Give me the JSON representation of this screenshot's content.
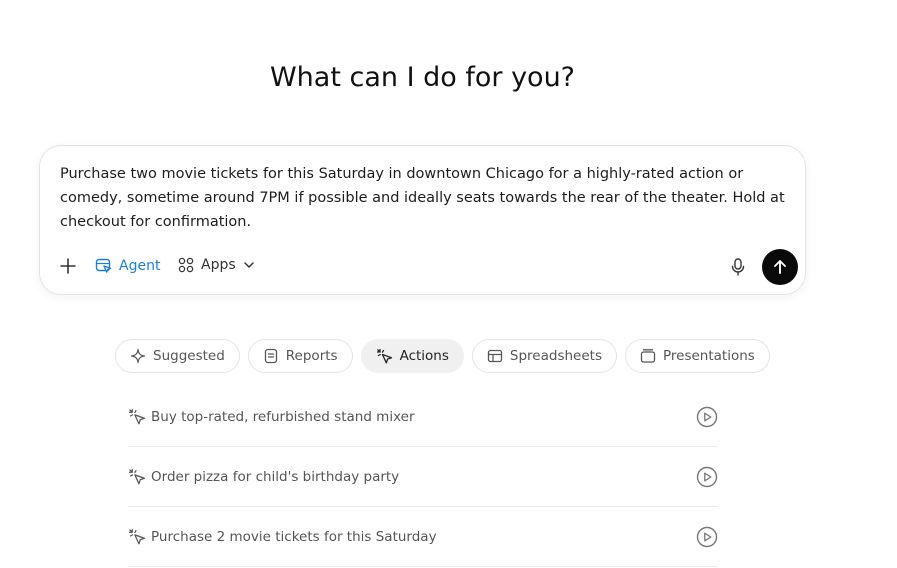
{
  "heading": "What can I do for you?",
  "composer": {
    "prompt_text": "Purchase two movie tickets for this Saturday in downtown Chicago for a highly-rated action or comedy, sometime around 7PM if possible and ideally seats towards the rear of the theater. Hold at checkout for confirmation.",
    "agent_label": "Agent",
    "apps_label": "Apps",
    "icons": {
      "add": "plus-icon",
      "agent": "agent-icon",
      "apps": "apps-grid-icon",
      "dropdown": "chevron-down-icon",
      "mic": "microphone-icon",
      "send": "arrow-up-icon"
    }
  },
  "tabs": [
    {
      "label": "Suggested",
      "icon": "sparkle-icon",
      "active": false
    },
    {
      "label": "Reports",
      "icon": "document-icon",
      "active": false
    },
    {
      "label": "Actions",
      "icon": "cursor-click-icon",
      "active": true
    },
    {
      "label": "Spreadsheets",
      "icon": "table-icon",
      "active": false
    },
    {
      "label": "Presentations",
      "icon": "slides-icon",
      "active": false
    }
  ],
  "actions": [
    {
      "label": "Buy top-rated, refurbished stand mixer",
      "icon": "cursor-click-icon",
      "trailing_icon": "play-circle-icon"
    },
    {
      "label": "Order pizza for child's birthday party",
      "icon": "cursor-click-icon",
      "trailing_icon": "play-circle-icon"
    },
    {
      "label": "Purchase 2 movie tickets for this Saturday",
      "icon": "cursor-click-icon",
      "trailing_icon": "play-circle-icon"
    }
  ],
  "colors": {
    "accent": "#1a7fd8",
    "send_button": "#0a0a0a",
    "active_tab_bg": "#f0f0f0"
  }
}
